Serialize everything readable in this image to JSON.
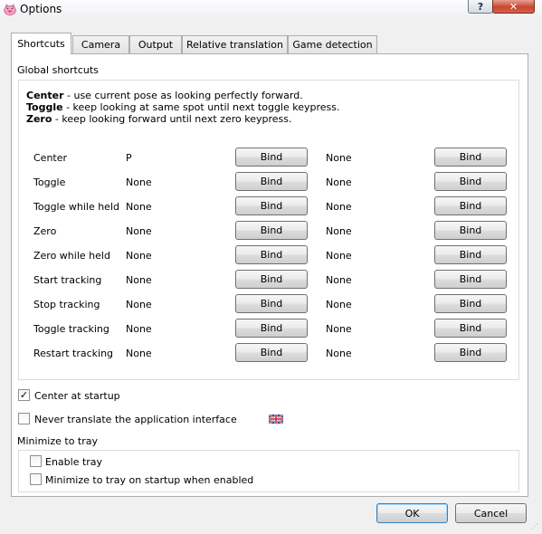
{
  "window": {
    "title": "Options",
    "help_glyph": "?",
    "close_glyph": "✕",
    "app_icon": "pig-icon"
  },
  "tabs": [
    {
      "label": "Shortcuts",
      "active": true
    },
    {
      "label": "Camera",
      "active": false
    },
    {
      "label": "Output",
      "active": false
    },
    {
      "label": "Relative translation",
      "active": false
    },
    {
      "label": "Game detection",
      "active": false
    }
  ],
  "shortcuts": {
    "group_title": "Global shortcuts",
    "descriptions": [
      {
        "key": "Center",
        "text": " - use current pose as looking perfectly forward."
      },
      {
        "key": "Toggle",
        "text": " - keep looking at same spot until next toggle keypress."
      },
      {
        "key": "Zero",
        "text": " - keep looking forward until next zero keypress."
      }
    ],
    "rows": [
      {
        "label": "Center",
        "key1": "P",
        "bind1": "Bind",
        "key2": "None",
        "bind2": "Bind"
      },
      {
        "label": "Toggle",
        "key1": "None",
        "bind1": "Bind",
        "key2": "None",
        "bind2": "Bind"
      },
      {
        "label": "Toggle while held",
        "key1": "None",
        "bind1": "Bind",
        "key2": "None",
        "bind2": "Bind"
      },
      {
        "label": "Zero",
        "key1": "None",
        "bind1": "Bind",
        "key2": "None",
        "bind2": "Bind"
      },
      {
        "label": "Zero while held",
        "key1": "None",
        "bind1": "Bind",
        "key2": "None",
        "bind2": "Bind"
      },
      {
        "label": "Start tracking",
        "key1": "None",
        "bind1": "Bind",
        "key2": "None",
        "bind2": "Bind"
      },
      {
        "label": "Stop tracking",
        "key1": "None",
        "bind1": "Bind",
        "key2": "None",
        "bind2": "Bind"
      },
      {
        "label": "Toggle tracking",
        "key1": "None",
        "bind1": "Bind",
        "key2": "None",
        "bind2": "Bind"
      },
      {
        "label": "Restart tracking",
        "key1": "None",
        "bind1": "Bind",
        "key2": "None",
        "bind2": "Bind"
      }
    ]
  },
  "options": {
    "center_at_startup": {
      "label": "Center at startup",
      "checked": true,
      "mark": "✓"
    },
    "never_translate": {
      "label": "Never translate the application interface",
      "checked": false,
      "flag_icon": "uk-flag-icon"
    }
  },
  "tray": {
    "group_title": "Minimize to tray",
    "enable_tray": {
      "label": "Enable tray",
      "checked": false
    },
    "minimize_on_startup": {
      "label": "Minimize to tray on startup when enabled",
      "checked": false
    }
  },
  "dialog": {
    "ok_label": "OK",
    "cancel_label": "Cancel"
  }
}
